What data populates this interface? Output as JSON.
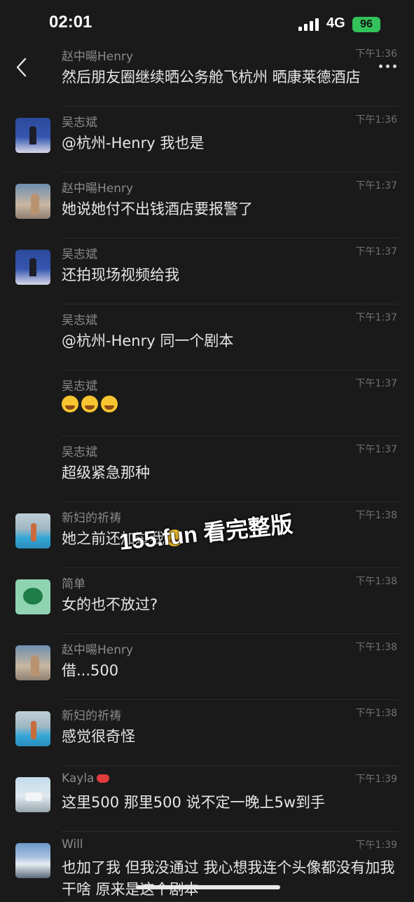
{
  "status_bar": {
    "time": "02:01",
    "network": "4G",
    "battery": "96"
  },
  "messages": [
    {
      "name": "赵中暘Henry",
      "time": "下午1:36",
      "text": "然后朋友圈继续晒公务舱飞杭州 晒康莱德酒店",
      "avatar": ""
    },
    {
      "name": "吴志斌",
      "time": "下午1:36",
      "text": "@杭州-Henry 我也是",
      "avatar": "podium"
    },
    {
      "name": "赵中暘Henry",
      "time": "下午1:37",
      "text": "她说她付不出钱酒店要报警了",
      "avatar": "gym"
    },
    {
      "name": "吴志斌",
      "time": "下午1:37",
      "text": "还拍现场视频给我",
      "avatar": "podium"
    },
    {
      "name": "吴志斌",
      "time": "下午1:37",
      "text": "@杭州-Henry 同一个剧本",
      "avatar": ""
    },
    {
      "name": "吴志斌",
      "time": "下午1:37",
      "text": "",
      "emojis": 3,
      "avatar": ""
    },
    {
      "name": "吴志斌",
      "time": "下午1:37",
      "text": "超级紧急那种",
      "avatar": ""
    },
    {
      "name": "新妇的祈祷",
      "time": "下午1:38",
      "text": "她之前还加过我",
      "emoji_after": true,
      "avatar": "pool"
    },
    {
      "name": "简单",
      "time": "下午1:38",
      "text": "女的也不放过?",
      "avatar": "frog"
    },
    {
      "name": "赵中暘Henry",
      "time": "下午1:38",
      "text": "借...500",
      "avatar": "gym"
    },
    {
      "name": "新妇的祈祷",
      "time": "下午1:38",
      "text": "感觉很奇怪",
      "avatar": "pool"
    },
    {
      "name": "Kayla",
      "time": "下午1:39",
      "text": "这里500 那里500 说不定一晚上5w到手",
      "avatar": "city",
      "name_icon": "lips-icon"
    },
    {
      "name": "Will",
      "time": "下午1:39",
      "text": "也加了我 但我没通过 我心想我连个头像都没有加我干啥 原来是这个剧本",
      "avatar": "mountain"
    }
  ],
  "watermark": "155.fun 看完整版",
  "icons": {
    "back": "chevron-left-icon",
    "more": "more-dots-icon"
  },
  "colors": {
    "background": "#1a1a1a",
    "battery": "#33c25a"
  }
}
